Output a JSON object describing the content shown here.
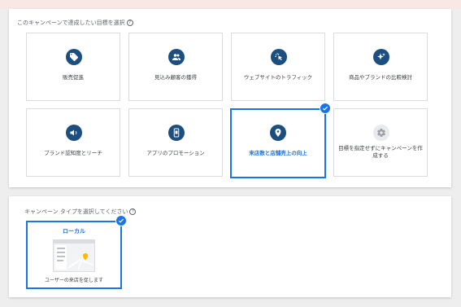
{
  "goals_section": {
    "title": "このキャンペーンで達成したい目標を選択",
    "cards": [
      {
        "label": "販売促進",
        "icon": "tag-icon"
      },
      {
        "label": "見込み顧客の獲得",
        "icon": "people-icon"
      },
      {
        "label": "ウェブサイトのトラフィック",
        "icon": "cursor-click-icon"
      },
      {
        "label": "商品やブランドの比較検討",
        "icon": "sparkle-icon"
      },
      {
        "label": "ブランド認知度とリーチ",
        "icon": "speaker-icon"
      },
      {
        "label": "アプリのプロモーション",
        "icon": "phone-icon"
      },
      {
        "label": "来店数と店舗売上の向上",
        "icon": "location-pin-icon",
        "selected": true
      },
      {
        "label": "目標を指定せずにキャンペーンを作成する",
        "icon": "gear-icon"
      }
    ]
  },
  "type_section": {
    "title": "キャンペーン タイプを選択してください",
    "local_card": {
      "title": "ローカル",
      "description": "ユーザーの来店を促します",
      "selected": true
    }
  },
  "colors": {
    "accent": "#1a73e8",
    "icon_bg": "#1c4f7f",
    "background": "#eeeeee"
  }
}
